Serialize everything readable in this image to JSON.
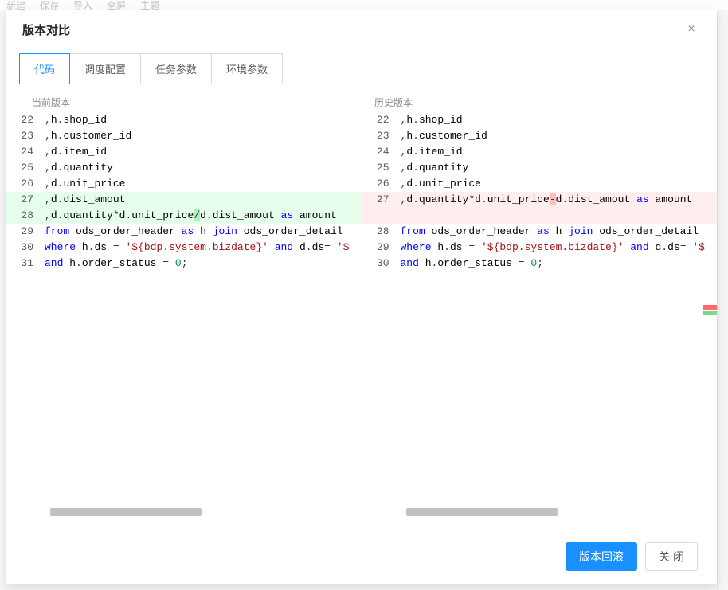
{
  "toolbar": {
    "new": "新建",
    "save": "保存",
    "import": "导入",
    "fullscreen": "全屏",
    "theme": "主题"
  },
  "modal": {
    "title": "版本对比",
    "close_icon": "×",
    "tabs": [
      {
        "key": "code",
        "label": "代码",
        "active": true
      },
      {
        "key": "schedule",
        "label": "调度配置",
        "active": false
      },
      {
        "key": "taskparams",
        "label": "任务参数",
        "active": false
      },
      {
        "key": "envparams",
        "label": "环境参数",
        "active": false
      }
    ],
    "current_label": "当前版本",
    "history_label": "历史版本",
    "footer": {
      "rollback": "版本回滚",
      "close": "关闭"
    }
  },
  "diff": {
    "left": [
      {
        "n": 22,
        "type": "ctx",
        "tokens": [
          [
            ",",
            "punc"
          ],
          [
            "h",
            ""
          ],
          [
            ".",
            "punc"
          ],
          [
            "shop_id",
            ""
          ]
        ]
      },
      {
        "n": 23,
        "type": "ctx",
        "tokens": [
          [
            ",",
            "punc"
          ],
          [
            "h",
            ""
          ],
          [
            ".",
            "punc"
          ],
          [
            "customer_id",
            ""
          ]
        ]
      },
      {
        "n": 24,
        "type": "ctx",
        "tokens": [
          [
            ",",
            "punc"
          ],
          [
            "d",
            ""
          ],
          [
            ".",
            "punc"
          ],
          [
            "item_id",
            ""
          ]
        ]
      },
      {
        "n": 25,
        "type": "ctx",
        "tokens": [
          [
            ",",
            "punc"
          ],
          [
            "d",
            ""
          ],
          [
            ".",
            "punc"
          ],
          [
            "quantity",
            ""
          ]
        ]
      },
      {
        "n": 26,
        "type": "ctx",
        "tokens": [
          [
            ",",
            "punc"
          ],
          [
            "d",
            ""
          ],
          [
            ".",
            "punc"
          ],
          [
            "unit_price",
            ""
          ]
        ]
      },
      {
        "n": 27,
        "type": "add",
        "tokens": [
          [
            ",",
            "punc"
          ],
          [
            "d",
            ""
          ],
          [
            ".",
            "punc"
          ],
          [
            "dist_amout",
            ""
          ]
        ]
      },
      {
        "n": 28,
        "type": "addhl",
        "tokens": [
          [
            ",",
            "punc"
          ],
          [
            "d",
            ""
          ],
          [
            ".",
            "punc"
          ],
          [
            "quantity",
            ""
          ],
          [
            "*",
            "op"
          ],
          [
            "d",
            ""
          ],
          [
            ".",
            "punc"
          ],
          [
            "unit_price",
            ""
          ],
          [
            "/",
            "op",
            "hl"
          ],
          [
            "d",
            ""
          ],
          [
            ".",
            "punc"
          ],
          [
            "dist_amout",
            ""
          ],
          [
            " ",
            ""
          ],
          [
            "as",
            "kw"
          ],
          [
            " ",
            ""
          ],
          [
            "amount",
            ""
          ]
        ]
      },
      {
        "n": 29,
        "type": "ctx",
        "tokens": [
          [
            "from",
            "kw"
          ],
          [
            " ",
            ""
          ],
          [
            "ods_order_header",
            ""
          ],
          [
            " ",
            ""
          ],
          [
            "as",
            "kw"
          ],
          [
            " ",
            ""
          ],
          [
            "h",
            ""
          ],
          [
            " ",
            ""
          ],
          [
            "join",
            "kw"
          ],
          [
            " ",
            ""
          ],
          [
            "ods_order_detail",
            ""
          ]
        ]
      },
      {
        "n": 30,
        "type": "ctx",
        "tokens": [
          [
            "where",
            "kw"
          ],
          [
            " ",
            ""
          ],
          [
            "h",
            ""
          ],
          [
            ".",
            "punc"
          ],
          [
            "ds",
            ""
          ],
          [
            " ",
            ""
          ],
          [
            "=",
            "op"
          ],
          [
            " ",
            ""
          ],
          [
            "'${bdp.system.bizdate}'",
            "str"
          ],
          [
            " ",
            ""
          ],
          [
            "and",
            "kw"
          ],
          [
            " ",
            ""
          ],
          [
            "d",
            ""
          ],
          [
            ".",
            "punc"
          ],
          [
            "ds",
            ""
          ],
          [
            "=",
            "op"
          ],
          [
            " ",
            ""
          ],
          [
            "'$",
            "str"
          ]
        ]
      },
      {
        "n": 31,
        "type": "ctx",
        "tokens": [
          [
            "and",
            "kw"
          ],
          [
            " ",
            ""
          ],
          [
            "h",
            ""
          ],
          [
            ".",
            "punc"
          ],
          [
            "order_status",
            ""
          ],
          [
            " ",
            ""
          ],
          [
            "=",
            "op"
          ],
          [
            " ",
            ""
          ],
          [
            "0",
            "num"
          ],
          [
            ";",
            "punc"
          ]
        ]
      }
    ],
    "right": [
      {
        "n": 22,
        "type": "ctx",
        "tokens": [
          [
            ",",
            "punc"
          ],
          [
            "h",
            ""
          ],
          [
            ".",
            "punc"
          ],
          [
            "shop_id",
            ""
          ]
        ]
      },
      {
        "n": 23,
        "type": "ctx",
        "tokens": [
          [
            ",",
            "punc"
          ],
          [
            "h",
            ""
          ],
          [
            ".",
            "punc"
          ],
          [
            "customer_id",
            ""
          ]
        ]
      },
      {
        "n": 24,
        "type": "ctx",
        "tokens": [
          [
            ",",
            "punc"
          ],
          [
            "d",
            ""
          ],
          [
            ".",
            "punc"
          ],
          [
            "item_id",
            ""
          ]
        ]
      },
      {
        "n": 25,
        "type": "ctx",
        "tokens": [
          [
            ",",
            "punc"
          ],
          [
            "d",
            ""
          ],
          [
            ".",
            "punc"
          ],
          [
            "quantity",
            ""
          ]
        ]
      },
      {
        "n": 26,
        "type": "ctx",
        "tokens": [
          [
            ",",
            "punc"
          ],
          [
            "d",
            ""
          ],
          [
            ".",
            "punc"
          ],
          [
            "unit_price",
            ""
          ]
        ]
      },
      {
        "n": 27,
        "type": "delhl",
        "tokens": [
          [
            ",",
            "punc"
          ],
          [
            "d",
            ""
          ],
          [
            ".",
            "punc"
          ],
          [
            "quantity",
            ""
          ],
          [
            "*",
            "op"
          ],
          [
            "d",
            ""
          ],
          [
            ".",
            "punc"
          ],
          [
            "unit_price",
            ""
          ],
          [
            "-",
            "op",
            "hl"
          ],
          [
            "d",
            ""
          ],
          [
            ".",
            "punc"
          ],
          [
            "dist_amout",
            ""
          ],
          [
            " ",
            ""
          ],
          [
            "as",
            "kw"
          ],
          [
            " ",
            ""
          ],
          [
            "amount",
            ""
          ]
        ]
      },
      {
        "n": "",
        "type": "del",
        "tokens": []
      },
      {
        "n": 28,
        "type": "ctx",
        "tokens": [
          [
            "from",
            "kw"
          ],
          [
            " ",
            ""
          ],
          [
            "ods_order_header",
            ""
          ],
          [
            " ",
            ""
          ],
          [
            "as",
            "kw"
          ],
          [
            " ",
            ""
          ],
          [
            "h",
            ""
          ],
          [
            " ",
            ""
          ],
          [
            "join",
            "kw"
          ],
          [
            " ",
            ""
          ],
          [
            "ods_order_detail",
            ""
          ]
        ]
      },
      {
        "n": 29,
        "type": "ctx",
        "tokens": [
          [
            "where",
            "kw"
          ],
          [
            " ",
            ""
          ],
          [
            "h",
            ""
          ],
          [
            ".",
            "punc"
          ],
          [
            "ds",
            ""
          ],
          [
            " ",
            ""
          ],
          [
            "=",
            "op"
          ],
          [
            " ",
            ""
          ],
          [
            "'${bdp.system.bizdate}'",
            "str"
          ],
          [
            " ",
            ""
          ],
          [
            "and",
            "kw"
          ],
          [
            " ",
            ""
          ],
          [
            "d",
            ""
          ],
          [
            ".",
            "punc"
          ],
          [
            "ds",
            ""
          ],
          [
            "=",
            "op"
          ],
          [
            " ",
            ""
          ],
          [
            "'$",
            "str"
          ]
        ]
      },
      {
        "n": 30,
        "type": "ctx",
        "tokens": [
          [
            "and",
            "kw"
          ],
          [
            " ",
            ""
          ],
          [
            "h",
            ""
          ],
          [
            ".",
            "punc"
          ],
          [
            "order_status",
            ""
          ],
          [
            " ",
            ""
          ],
          [
            "=",
            "op"
          ],
          [
            " ",
            ""
          ],
          [
            "0",
            "num"
          ],
          [
            ";",
            "punc"
          ]
        ]
      }
    ]
  }
}
